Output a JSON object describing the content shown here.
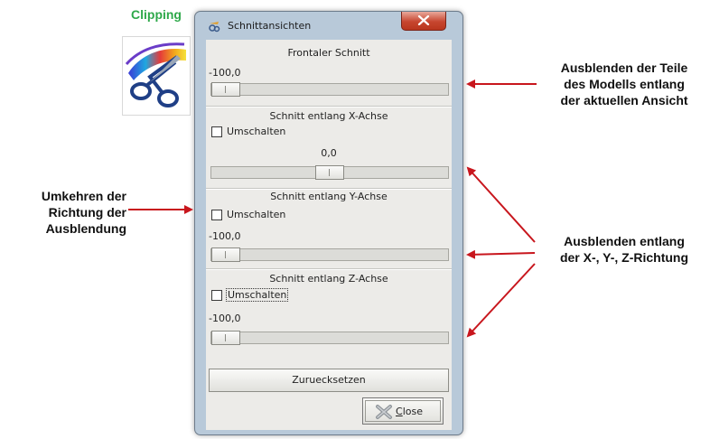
{
  "side_icon": {
    "title": "Clipping"
  },
  "window": {
    "title": "Schnittansichten"
  },
  "frontal": {
    "title": "Frontaler Schnitt",
    "value": "-100,0",
    "slider_fraction": 0.0
  },
  "x_axis": {
    "title": "Schnitt entlang X-Achse",
    "toggle_label": "Umschalten",
    "toggle_checked": false,
    "value": "0,0",
    "slider_fraction": 0.5
  },
  "y_axis": {
    "title": "Schnitt entlang Y-Achse",
    "toggle_label": "Umschalten",
    "toggle_checked": false,
    "value": "-100,0",
    "slider_fraction": 0.0
  },
  "z_axis": {
    "title": "Schnitt entlang Z-Achse",
    "toggle_label": "Umschalten",
    "toggle_checked": false,
    "value": "-100,0",
    "slider_fraction": 0.0
  },
  "buttons": {
    "reset_label": "Zuruecksetzen",
    "close_label": "Close",
    "close_mnemonic": "C",
    "close_rest": "lose"
  },
  "annotations": {
    "right_top": [
      "Ausblenden der Teile",
      "des Modells entlang",
      "der aktuellen Ansicht"
    ],
    "right_bottom": [
      "Ausblenden entlang",
      "der X-, Y-, Z-Richtung"
    ],
    "left": [
      "Umkehren der",
      "Richtung der",
      "Ausblendung"
    ]
  },
  "colors": {
    "arrow": "#c8161d",
    "clipping_title": "#2ea84a",
    "close_button": "#c7462f"
  }
}
